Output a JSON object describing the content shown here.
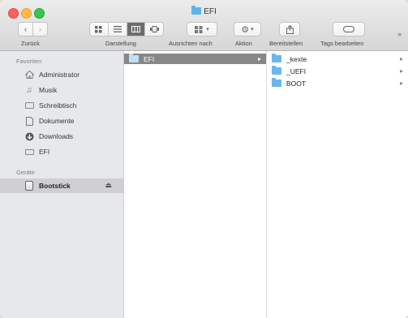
{
  "window": {
    "title": "EFI"
  },
  "toolbar": {
    "back_label": "Zurück",
    "view_label": "Darstellung",
    "arrange_label": "Ausrichten nach",
    "action_label": "Aktion",
    "share_label": "Bereitstellen",
    "tags_label": "Tags bearbeiten",
    "more_glyph": "»",
    "back_glyph": "‹",
    "forward_glyph": "›",
    "view_modes": [
      "icons",
      "list",
      "columns",
      "coverflow"
    ],
    "active_view": "columns"
  },
  "sidebar": {
    "favorites_header": "Favoriten",
    "devices_header": "Geräte",
    "favorites": [
      {
        "label": "Administrator",
        "icon": "home-icon"
      },
      {
        "label": "Musik",
        "icon": "music-icon"
      },
      {
        "label": "Schreibtisch",
        "icon": "desktop-icon"
      },
      {
        "label": "Dokumente",
        "icon": "documents-icon"
      },
      {
        "label": "Downloads",
        "icon": "downloads-icon"
      },
      {
        "label": "EFI",
        "icon": "drive-icon"
      }
    ],
    "devices": [
      {
        "label": "Bootstick",
        "icon": "usb-drive-icon",
        "eject": "⏏",
        "selected": true
      }
    ]
  },
  "columns": {
    "col1": [
      {
        "name": "EFI",
        "selected": true
      }
    ],
    "col2": [
      {
        "name": "_kexte"
      },
      {
        "name": "_UEFI"
      },
      {
        "name": "BOOT"
      }
    ]
  },
  "colors": {
    "folder": "#6ab6ee",
    "selection_gray": "#878787",
    "sidebar_bg": "#e6e8ec"
  }
}
